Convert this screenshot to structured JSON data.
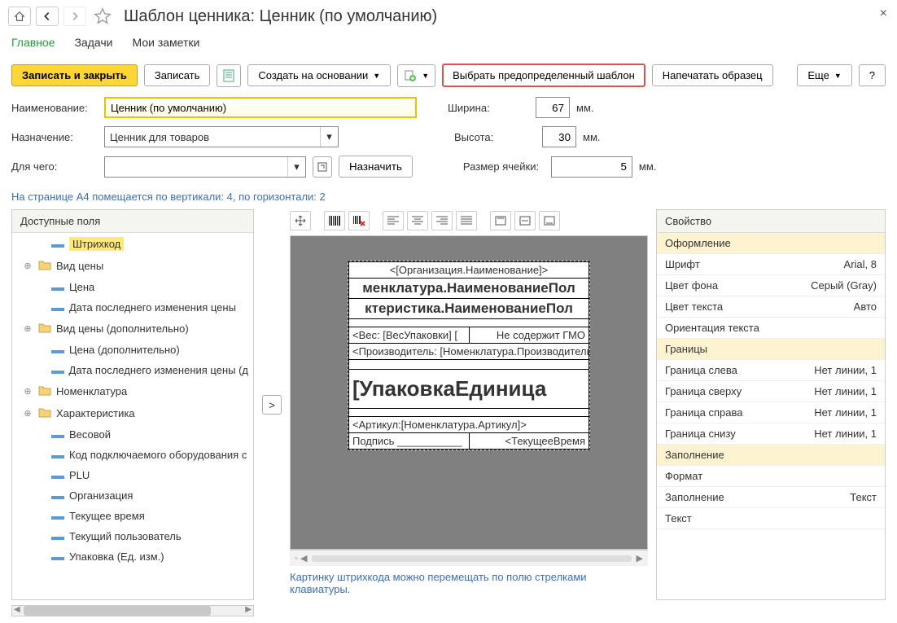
{
  "title": "Шаблон ценника: Ценник (по умолчанию)",
  "tabs": [
    "Главное",
    "Задачи",
    "Мои заметки"
  ],
  "toolbar": {
    "save_close": "Записать и закрыть",
    "save": "Записать",
    "create_based": "Создать на основании",
    "select_predefined": "Выбрать предопределенный шаблон",
    "print_sample": "Напечатать образец",
    "more": "Еще",
    "help": "?"
  },
  "form": {
    "name_label": "Наименование:",
    "name_value": "Ценник (по умолчанию)",
    "purpose_label": "Назначение:",
    "purpose_value": "Ценник для товаров",
    "for_label": "Для чего:",
    "for_value": "",
    "assign": "Назначить",
    "width_label": "Ширина:",
    "width_value": "67",
    "height_label": "Высота:",
    "height_value": "30",
    "cellsize_label": "Размер ячейки:",
    "cellsize_value": "5",
    "unit": "мм."
  },
  "info_line": "На странице А4 помещается по вертикали: 4, по горизонтали: 2",
  "left_panel": {
    "header": "Доступные поля",
    "items": [
      {
        "label": "Штрихкод",
        "type": "field",
        "indent": 1,
        "selected": true
      },
      {
        "label": "Вид цены",
        "type": "folder",
        "indent": 0,
        "expandable": true
      },
      {
        "label": "Цена",
        "type": "field",
        "indent": 1
      },
      {
        "label": "Дата последнего изменения цены",
        "type": "field",
        "indent": 1
      },
      {
        "label": "Вид цены (дополнительно)",
        "type": "folder",
        "indent": 0,
        "expandable": true
      },
      {
        "label": "Цена (дополнительно)",
        "type": "field",
        "indent": 1
      },
      {
        "label": "Дата последнего изменения цены (д",
        "type": "field",
        "indent": 1
      },
      {
        "label": "Номенклатура",
        "type": "folder",
        "indent": 0,
        "expandable": true
      },
      {
        "label": "Характеристика",
        "type": "folder",
        "indent": 0,
        "expandable": true
      },
      {
        "label": "Весовой",
        "type": "field",
        "indent": 1
      },
      {
        "label": "Код подключаемого оборудования с",
        "type": "field",
        "indent": 1
      },
      {
        "label": "PLU",
        "type": "field",
        "indent": 1
      },
      {
        "label": "Организация",
        "type": "field",
        "indent": 1
      },
      {
        "label": "Текущее время",
        "type": "field",
        "indent": 1
      },
      {
        "label": "Текущий пользователь",
        "type": "field",
        "indent": 1
      },
      {
        "label": "Упаковка (Ед. изм.)",
        "type": "field",
        "indent": 1
      }
    ]
  },
  "canvas": {
    "org": "<[Организация.Наименование]>",
    "nom1": "менклатура.НаименованиеПол",
    "nom2": "ктеристика.НаименованиеПол",
    "weight": "<Вес: [ВесУпаковки] [",
    "gmo": "Не содержит ГМО",
    "maker": "<Производитель: [Номенклатура.Производитель",
    "pack": "[УпаковкаЕдиница",
    "article": "<Артикул:[Номенклатура.Артикул]>",
    "sign": "Подпись ___________",
    "time": "<ТекущееВремя"
  },
  "hint": "Картинку штрихкода можно перемещать по полю стрелками клавиатуры.",
  "right_panel": {
    "header": "Свойство",
    "groups": [
      {
        "group": "Оформление"
      },
      {
        "name": "Шрифт",
        "val": "Arial, 8"
      },
      {
        "name": "Цвет фона",
        "val": "Серый (Gray)"
      },
      {
        "name": "Цвет текста",
        "val": "Авто"
      },
      {
        "name": "Ориентация текста",
        "val": ""
      },
      {
        "group": "Границы"
      },
      {
        "name": "Граница слева",
        "val": "Нет линии, 1"
      },
      {
        "name": "Граница сверху",
        "val": "Нет линии, 1"
      },
      {
        "name": "Граница справа",
        "val": "Нет линии, 1"
      },
      {
        "name": "Граница снизу",
        "val": "Нет линии, 1"
      },
      {
        "group": "Заполнение"
      },
      {
        "name": "Формат",
        "val": ""
      },
      {
        "name": "Заполнение",
        "val": "Текст"
      },
      {
        "name": "Текст",
        "val": ""
      }
    ]
  }
}
